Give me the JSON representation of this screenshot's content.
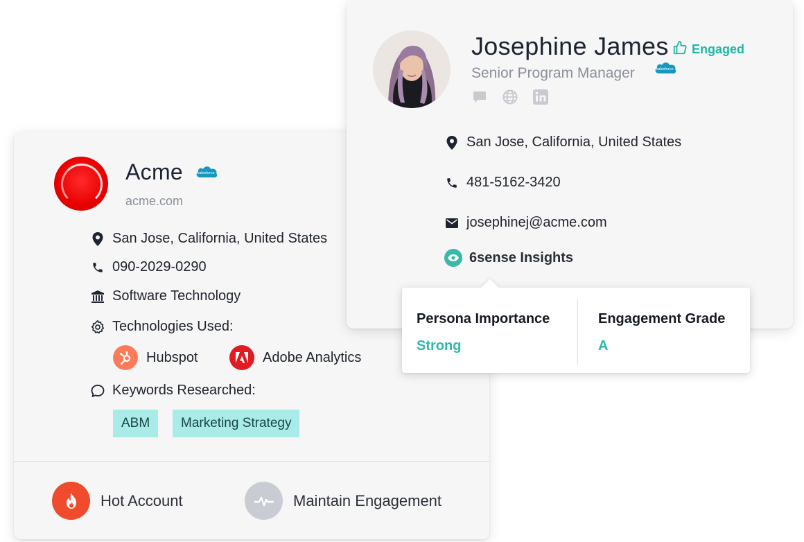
{
  "account": {
    "name": "Acme",
    "domain": "acme.com",
    "location": "San Jose, California, United States",
    "phone": "090-2029-0290",
    "industry": "Software Technology",
    "technologies_label": "Technologies Used:",
    "technologies": [
      {
        "name": "Hubspot",
        "icon": "hubspot-icon",
        "color": "#ff7a59"
      },
      {
        "name": "Adobe Analytics",
        "icon": "adobe-icon",
        "color": "#e01b22"
      }
    ],
    "keywords_label": "Keywords Researched:",
    "keywords": [
      "ABM",
      "Marketing Strategy"
    ],
    "statuses": [
      {
        "label": "Hot Account",
        "icon": "flame-icon",
        "color": "#ef4b2c"
      },
      {
        "label": "Maintain Engagement",
        "icon": "pulse-icon",
        "color": "#c9ccd3"
      }
    ]
  },
  "contact": {
    "name": "Josephine James",
    "engaged_label": "Engaged",
    "title": "Senior Program Manager",
    "location": "San Jose, California, United States",
    "phone": "481-5162-3420",
    "email": "josephinej@acme.com",
    "insights_label": "6sense Insights",
    "social_icons": [
      "chat-icon",
      "globe-icon",
      "linkedin-icon"
    ]
  },
  "insights": {
    "persona_label": "Persona Importance",
    "persona_value": "Strong",
    "grade_label": "Engagement Grade",
    "grade_value": "A"
  },
  "badges": {
    "salesforce_text": "salesforce"
  },
  "colors": {
    "accent_teal": "#1fb7a6",
    "tag_bg": "#a9ece7",
    "card_bg": "#f6f6f7"
  }
}
